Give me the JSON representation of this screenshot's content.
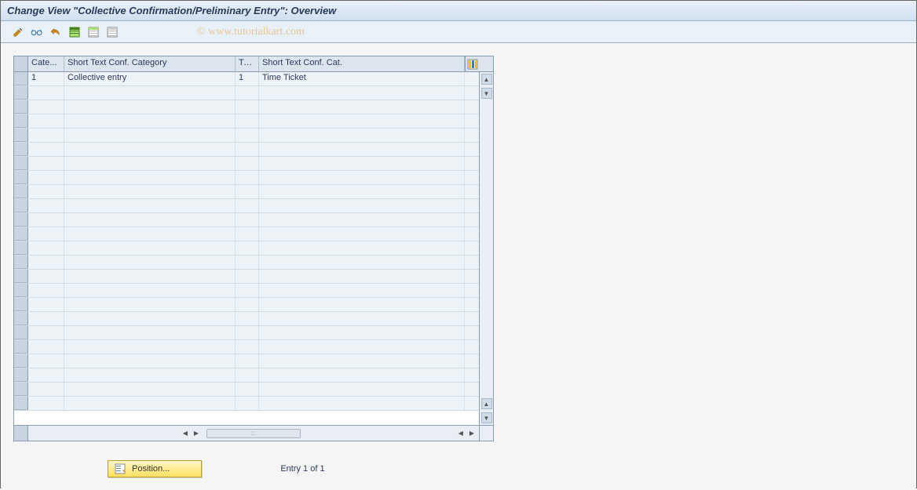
{
  "title": "Change View \"Collective Confirmation/Preliminary Entry\": Overview",
  "watermark": "© www.tutorialkart.com",
  "toolbar": {
    "icons": [
      "pencil-icon",
      "glasses-icon",
      "undo-icon",
      "select-all-icon",
      "select-block-icon",
      "deselect-all-icon"
    ]
  },
  "grid": {
    "columns": {
      "cate": "Cate...",
      "short_text_conf_category": "Short Text Conf. Category",
      "type": "Type",
      "short_text_conf_cat": "Short Text Conf. Cat."
    },
    "rows": [
      {
        "cate": "1",
        "short_text_conf_category": "Collective entry",
        "type": "1",
        "short_text_conf_cat": "Time Ticket"
      }
    ],
    "empty_row_count": 23
  },
  "footer": {
    "position_button": "Position...",
    "entry_status": "Entry 1 of 1"
  }
}
